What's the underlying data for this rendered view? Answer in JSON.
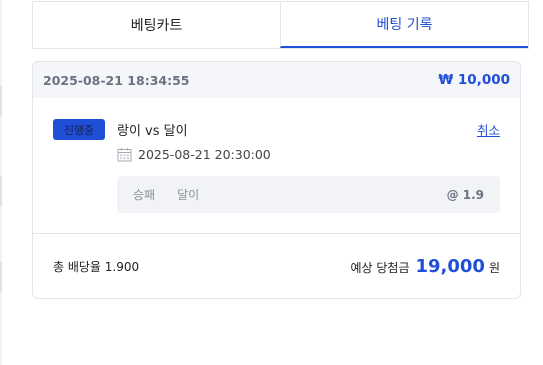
{
  "tabs": {
    "cart_label": "베팅카트",
    "history_label": "베팅 기록"
  },
  "bet": {
    "placed_at": "2025-08-21 18:34:55",
    "stake": "₩ 10,000",
    "status": "진행중",
    "match": "랑이 vs 달이",
    "cancel_label": "취소",
    "match_time": "2025-08-21 20:30:00",
    "market": "승패",
    "pick": "달이",
    "odds": "@ 1.9"
  },
  "summary": {
    "total_odds": "총 배당율 1.900",
    "expected_label": "예상 당첨금",
    "expected_amount": "19,000",
    "currency_unit": "원"
  },
  "colors": {
    "accent": "#1f4fd6",
    "header_bg": "#f4f6fa",
    "pick_bg": "#f1f3f7"
  },
  "icons": {
    "calendar": "calendar-icon"
  }
}
